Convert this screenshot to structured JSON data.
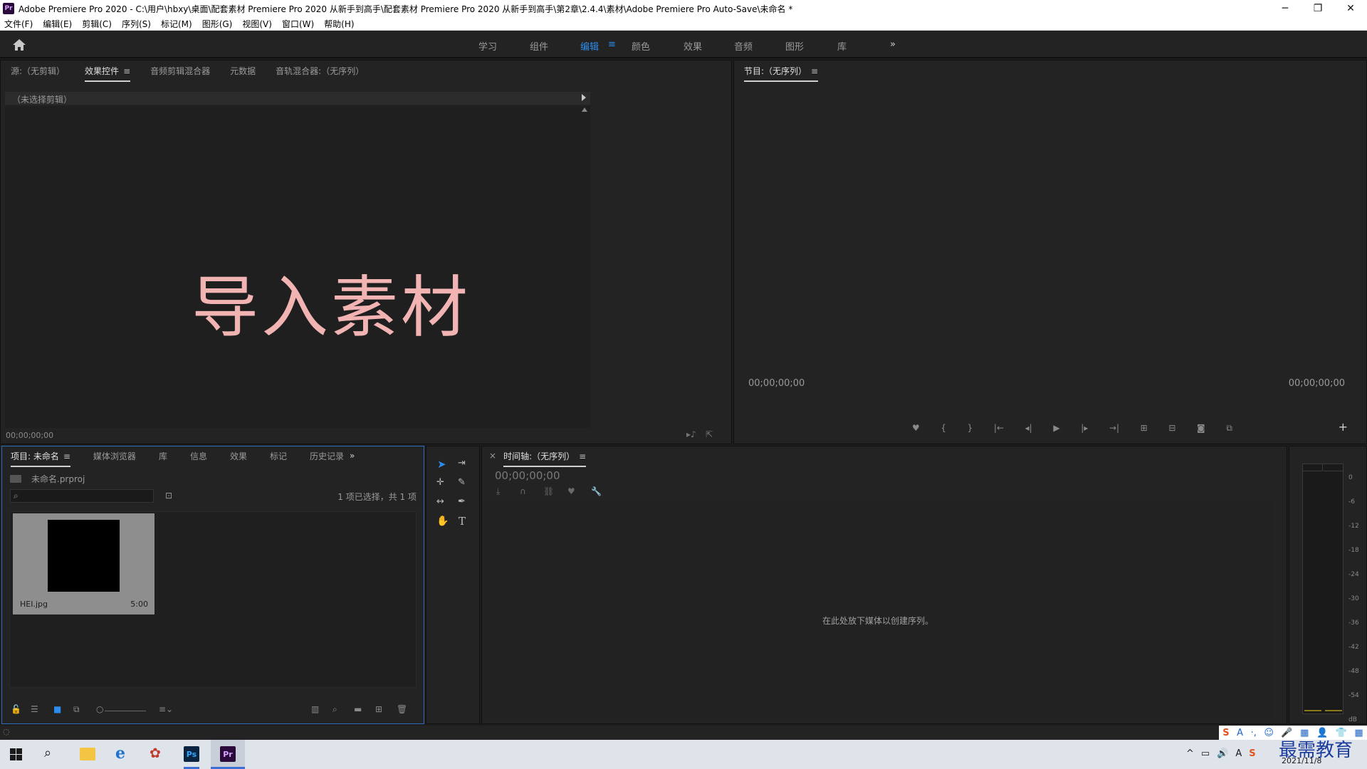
{
  "window": {
    "title": "Adobe Premiere Pro 2020 - C:\\用户\\hbxy\\桌面\\配套素材 Premiere Pro 2020 从新手到高手\\配套素材 Premiere Pro 2020 从新手到高手\\第2章\\2.4.4\\素材\\Adobe Premiere Pro Auto-Save\\未命名 *",
    "app_icon_label": "Pr",
    "minimize": "─",
    "restore": "❐",
    "close": "✕"
  },
  "menu": [
    "文件(F)",
    "编辑(E)",
    "剪辑(C)",
    "序列(S)",
    "标记(M)",
    "图形(G)",
    "视图(V)",
    "窗口(W)",
    "帮助(H)"
  ],
  "workspaces": {
    "items": [
      "学习",
      "组件",
      "编辑",
      "颜色",
      "效果",
      "音频",
      "图形",
      "库"
    ],
    "active": "编辑",
    "more": "»"
  },
  "source_panel": {
    "tabs": [
      "源:（无剪辑）",
      "效果控件",
      "音频剪辑混合器",
      "元数据",
      "音轨混合器:（无序列）"
    ],
    "active_tab": "效果控件",
    "no_clip": "（未选择剪辑）",
    "overlay_text": "导入素材",
    "timecode": "00;00;00;00"
  },
  "program_panel": {
    "tab": "节目:（无序列）",
    "timecode_left": "00;00;00;00",
    "timecode_right": "00;00;00;00",
    "add": "+"
  },
  "project_panel": {
    "tabs": [
      "项目: 未命名",
      "媒体浏览器",
      "库",
      "信息",
      "效果",
      "标记",
      "历史记录"
    ],
    "active_tab": "项目: 未命名",
    "more": "»",
    "project_file": "未命名.prproj",
    "search_placeholder": "",
    "selection_status": "1 项已选择，共 1 项",
    "item": {
      "name": "HEI.jpg",
      "duration": "5:00"
    }
  },
  "timeline_panel": {
    "tab": "时间轴:（无序列）",
    "close": "×",
    "timecode": "00;00;00;00",
    "drop_hint": "在此处放下媒体以创建序列。"
  },
  "audio_meter": {
    "scale": [
      "0",
      "-6",
      "-12",
      "-18",
      "-24",
      "-30",
      "-36",
      "-42",
      "-48",
      "-54",
      "dB"
    ]
  },
  "taskbar": {
    "date": "2021/11/8",
    "watermark": "最需教育",
    "ime_glyphs": [
      "S",
      "A",
      "·,",
      "☺",
      "🎤",
      "▦",
      "👤",
      "👕",
      "▦"
    ]
  },
  "colors": {
    "accent": "#2d8ceb",
    "overlay_text": "#f2b3b3",
    "panel_bg": "#232323",
    "frame_bg": "#1d1d1d"
  }
}
